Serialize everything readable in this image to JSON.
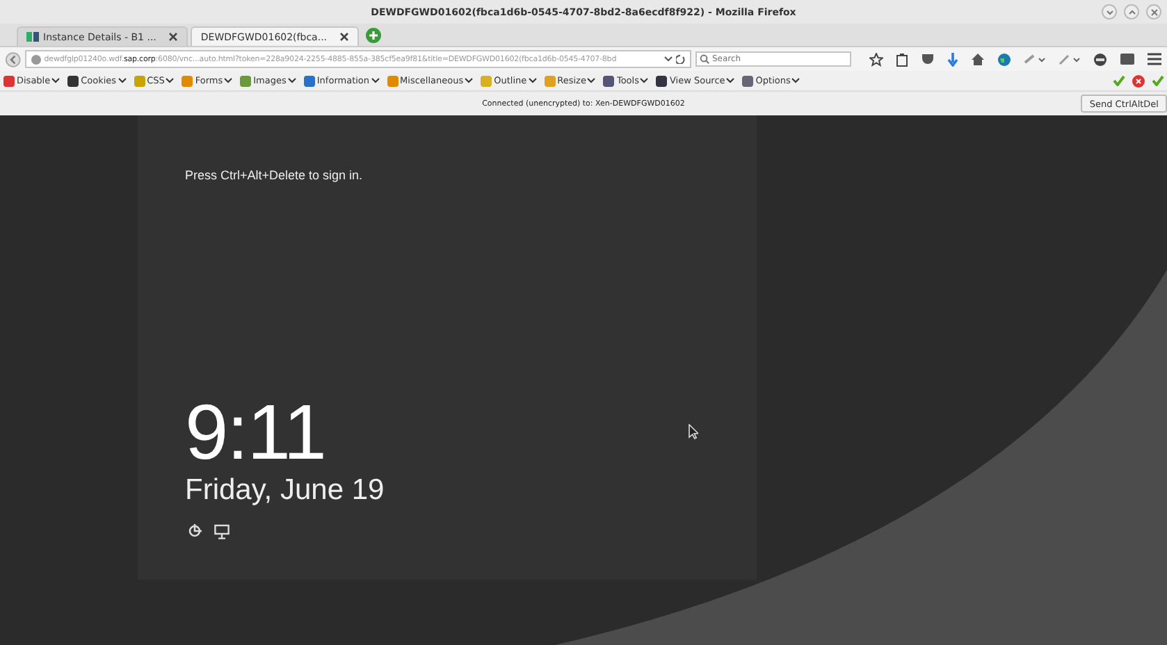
{
  "window": {
    "title": "DEWDFGWD01602(fbca1d6b-0545-4707-8bd2-8a6ecdf8f922) - Mozilla Firefox"
  },
  "tabs": [
    {
      "label": "Instance Details - B1 ...",
      "selected": false
    },
    {
      "label": "DEWDFGWD01602(fbca...",
      "selected": true
    }
  ],
  "address_bar": {
    "url": "dewdfglp01240o.wdf.**sap.corp**:6080/vnc...auto.html?token=228a9024-2255-4885-855a-385cf5ea9f81&title=DEWDFGWD01602(fbca1d6b-0545-4707-8bd"
  },
  "search": {
    "placeholder": "Search"
  },
  "dev_toolbar": [
    {
      "label": "Disable"
    },
    {
      "label": "Cookies"
    },
    {
      "label": "CSS"
    },
    {
      "label": "Forms"
    },
    {
      "label": "Images"
    },
    {
      "label": "Information"
    },
    {
      "label": "Miscellaneous"
    },
    {
      "label": "Outline"
    },
    {
      "label": "Resize"
    },
    {
      "label": "Tools"
    },
    {
      "label": "View Source"
    },
    {
      "label": "Options"
    }
  ],
  "vnc": {
    "status": "Connected (unencrypted) to: Xen-DEWDFGWD01602",
    "button": "Send CtrlAltDel"
  },
  "lock_screen": {
    "prompt": "Press Ctrl+Alt+Delete to sign in.",
    "time": "9:11",
    "date": "Friday, June 19"
  }
}
